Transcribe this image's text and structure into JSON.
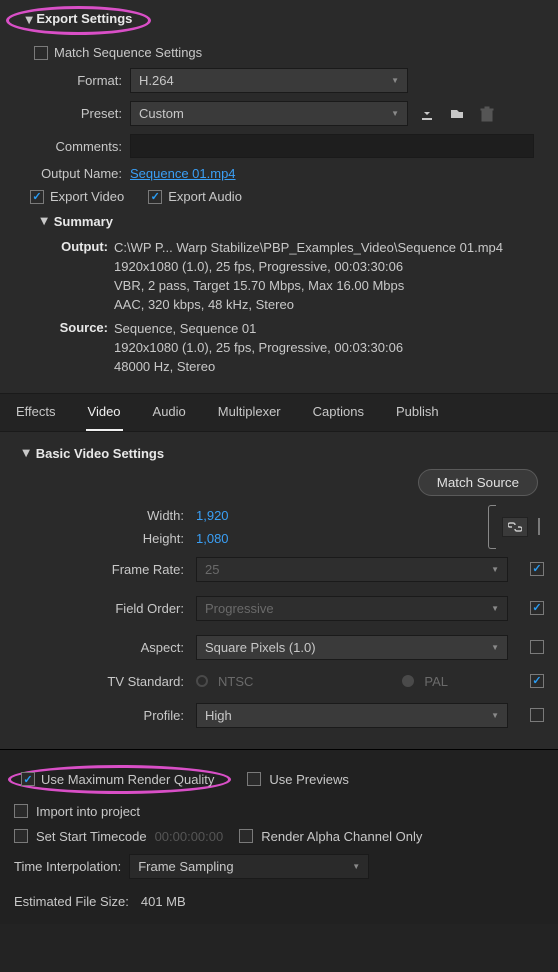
{
  "export": {
    "title": "Export Settings",
    "match_sequence": "Match Sequence Settings",
    "format_label": "Format:",
    "format_value": "H.264",
    "preset_label": "Preset:",
    "preset_value": "Custom",
    "comments_label": "Comments:",
    "comments_value": "",
    "output_name_label": "Output Name:",
    "output_name_value": "Sequence 01.mp4",
    "export_video": "Export Video",
    "export_audio": "Export Audio"
  },
  "summary": {
    "title": "Summary",
    "output_label": "Output:",
    "output_line1": "C:\\WP P... Warp Stabilize\\PBP_Examples_Video\\Sequence 01.mp4",
    "output_line2": "1920x1080 (1.0), 25 fps, Progressive, 00:03:30:06",
    "output_line3": "VBR, 2 pass, Target 15.70 Mbps, Max 16.00 Mbps",
    "output_line4": "AAC, 320 kbps, 48 kHz, Stereo",
    "source_label": "Source:",
    "source_line1": "Sequence, Sequence 01",
    "source_line2": "1920x1080 (1.0), 25 fps, Progressive, 00:03:30:06",
    "source_line3": "48000 Hz, Stereo"
  },
  "tabs": {
    "effects": "Effects",
    "video": "Video",
    "audio": "Audio",
    "multiplexer": "Multiplexer",
    "captions": "Captions",
    "publish": "Publish"
  },
  "basic": {
    "title": "Basic Video Settings",
    "match_source": "Match Source",
    "width_label": "Width:",
    "width_value": "1,920",
    "height_label": "Height:",
    "height_value": "1,080",
    "frame_rate_label": "Frame Rate:",
    "frame_rate_value": "25",
    "field_order_label": "Field Order:",
    "field_order_value": "Progressive",
    "aspect_label": "Aspect:",
    "aspect_value": "Square Pixels (1.0)",
    "tv_standard_label": "TV Standard:",
    "ntsc": "NTSC",
    "pal": "PAL",
    "profile_label": "Profile:",
    "profile_value": "High"
  },
  "bottom": {
    "max_render": "Use Maximum Render Quality",
    "use_previews": "Use Previews",
    "import_project": "Import into project",
    "set_start_tc": "Set Start Timecode",
    "timecode": "00:00:00:00",
    "render_alpha": "Render Alpha Channel Only",
    "time_interp_label": "Time Interpolation:",
    "time_interp_value": "Frame Sampling",
    "est_size_label": "Estimated File Size:",
    "est_size_value": "401 MB"
  }
}
